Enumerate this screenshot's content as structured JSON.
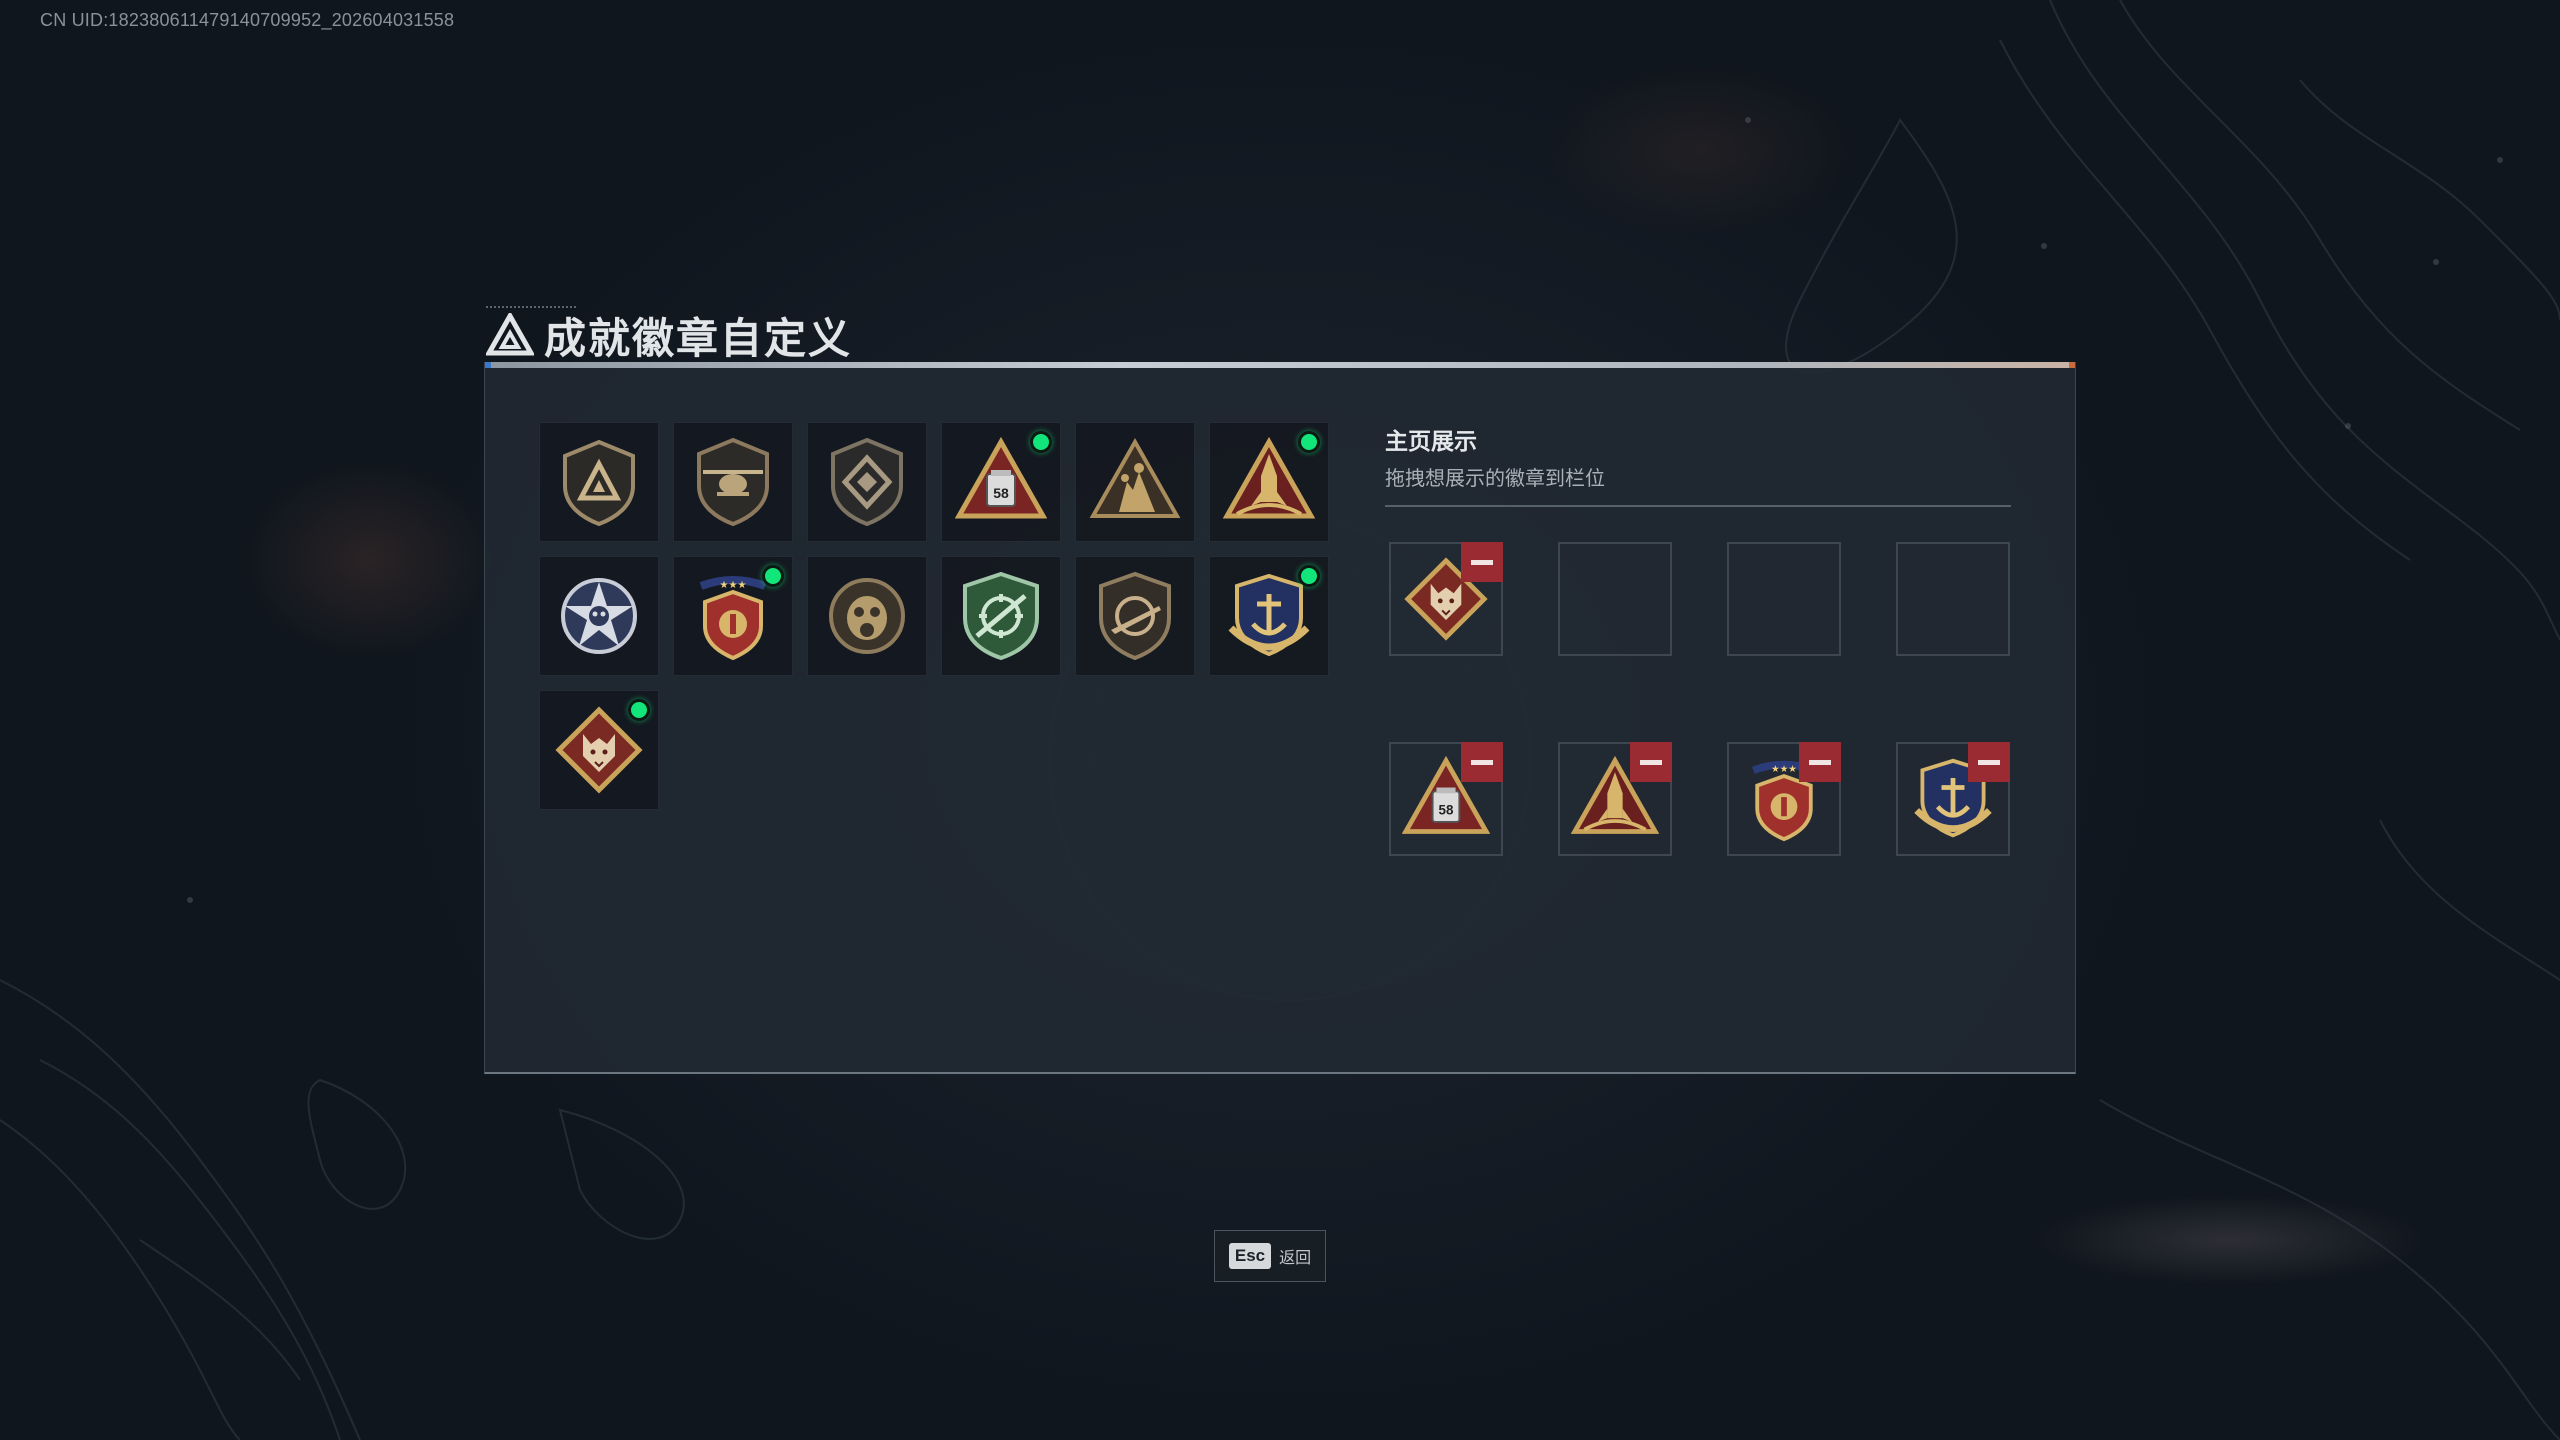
{
  "uid_text": "CN UID:18238061147914070​9952_202604031558",
  "title": {
    "text": "成就徽章自定义",
    "icon": "triangle-logo-icon"
  },
  "badge_grid": [
    {
      "icon": "triangle-shield-badge-icon",
      "new": false
    },
    {
      "icon": "helicopter-shield-badge-icon",
      "new": false
    },
    {
      "icon": "diamond-shield-badge-icon",
      "new": false
    },
    {
      "icon": "triangle-58-badge-icon",
      "new": true
    },
    {
      "icon": "soldiers-triangle-badge-icon",
      "new": false
    },
    {
      "icon": "rocket-triangle-badge-icon",
      "new": true
    },
    {
      "icon": "star-skull-badge-icon",
      "new": false
    },
    {
      "icon": "red-shield-stars-badge-icon",
      "new": true
    },
    {
      "icon": "gas-mask-badge-icon",
      "new": false
    },
    {
      "icon": "green-rifle-shield-badge-icon",
      "new": false
    },
    {
      "icon": "rifle-shield-badge-icon",
      "new": false
    },
    {
      "icon": "navy-anchor-shield-badge-icon",
      "new": true
    },
    {
      "icon": "wolf-diamond-badge-icon",
      "new": true
    }
  ],
  "showcase": {
    "title": "主页展示",
    "subtitle": "拖拽想展示的徽章到栏位",
    "slots": [
      {
        "icon": "wolf-diamond-badge-icon",
        "filled": true
      },
      {
        "icon": "",
        "filled": false
      },
      {
        "icon": "",
        "filled": false
      },
      {
        "icon": "",
        "filled": false
      },
      {
        "icon": "triangle-58-badge-icon",
        "filled": true
      },
      {
        "icon": "rocket-triangle-badge-icon",
        "filled": true
      },
      {
        "icon": "red-shield-stars-badge-icon",
        "filled": true
      },
      {
        "icon": "navy-anchor-shield-badge-icon",
        "filled": true
      }
    ]
  },
  "esc": {
    "key": "Esc",
    "label": "返回"
  },
  "badge_58_text": "58",
  "colors": {
    "new_dot": "#12e67a",
    "remove_button": "#9b2b33",
    "gold": "#c9a35a"
  }
}
